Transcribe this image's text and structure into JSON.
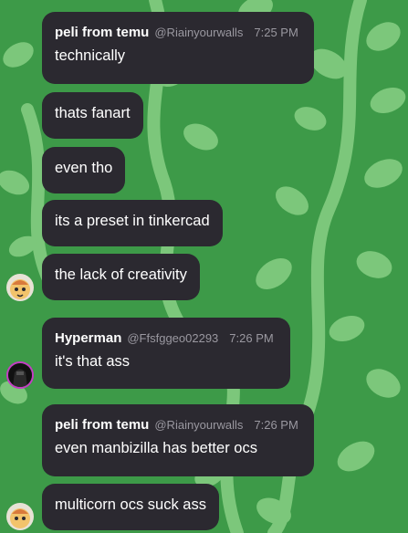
{
  "messages": [
    {
      "name": "peli from temu",
      "handle": "@Riainyourwalls",
      "time": "7:25 PM",
      "text": "technically"
    },
    {
      "text": "thats fanart"
    },
    {
      "text": "even tho"
    },
    {
      "text": "its a preset in tinkercad"
    },
    {
      "text": "the lack of creativity"
    },
    {
      "name": "Hyperman",
      "handle": "@Ffsfggeo02293",
      "time": "7:26 PM",
      "text": "it's that ass"
    },
    {
      "name": "peli from temu",
      "handle": "@Riainyourwalls",
      "time": "7:26 PM",
      "text": "even manbizilla has better ocs"
    },
    {
      "text": "multicorn ocs suck ass"
    }
  ],
  "avatars": {
    "peli": {
      "icon": "peli-avatar-icon",
      "color": "#f2c36b"
    },
    "hyperman": {
      "icon": "hyperman-avatar-icon",
      "color": "#1a1a1a"
    }
  },
  "colors": {
    "bubble": "#2b2930",
    "meta": "#9a98a0",
    "background": "#3f9a4a",
    "leaf": "#7bc77a"
  }
}
